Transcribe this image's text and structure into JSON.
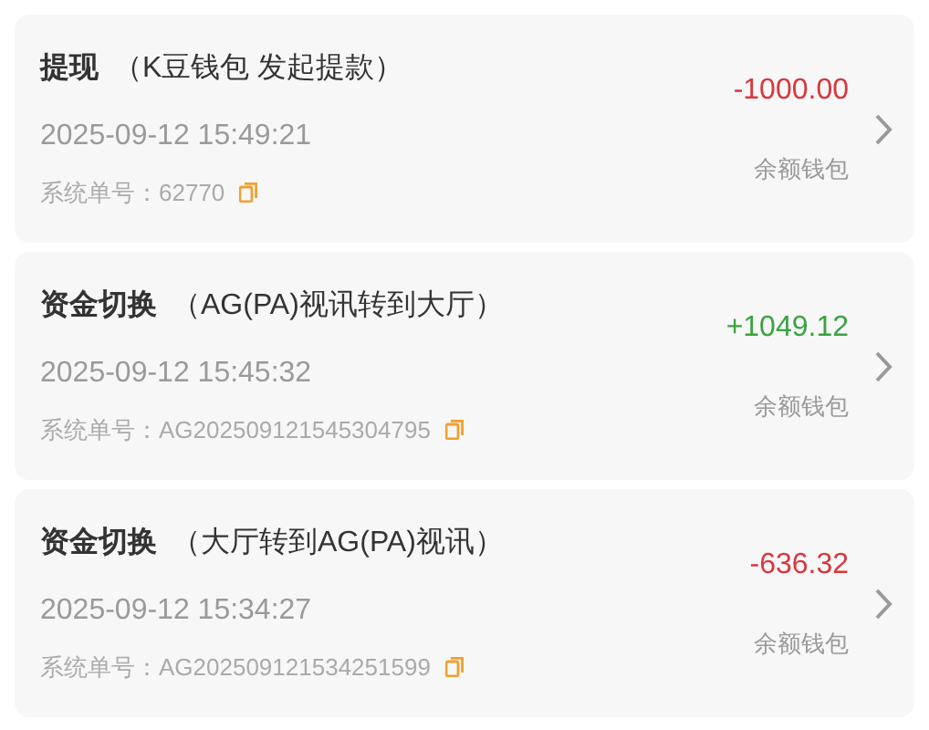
{
  "records": [
    {
      "title": "提现",
      "detail": "（K豆钱包 发起提款）",
      "time": "2025-09-12 15:49:21",
      "order": "系统单号：62770",
      "amount": "-1000.00",
      "kind": "debit",
      "wallet": "余额钱包"
    },
    {
      "title": "资金切换",
      "detail": "（AG(PA)视讯转到大厅）",
      "time": "2025-09-12 15:45:32",
      "order": "系统单号：AG202509121545304795",
      "amount": "+1049.12",
      "kind": "credit",
      "wallet": "余额钱包"
    },
    {
      "title": "资金切换",
      "detail": "（大厅转到AG(PA)视讯）",
      "time": "2025-09-12 15:34:27",
      "order": "系统单号：AG202509121534251599",
      "amount": "-636.32",
      "kind": "debit",
      "wallet": "余额钱包"
    }
  ]
}
